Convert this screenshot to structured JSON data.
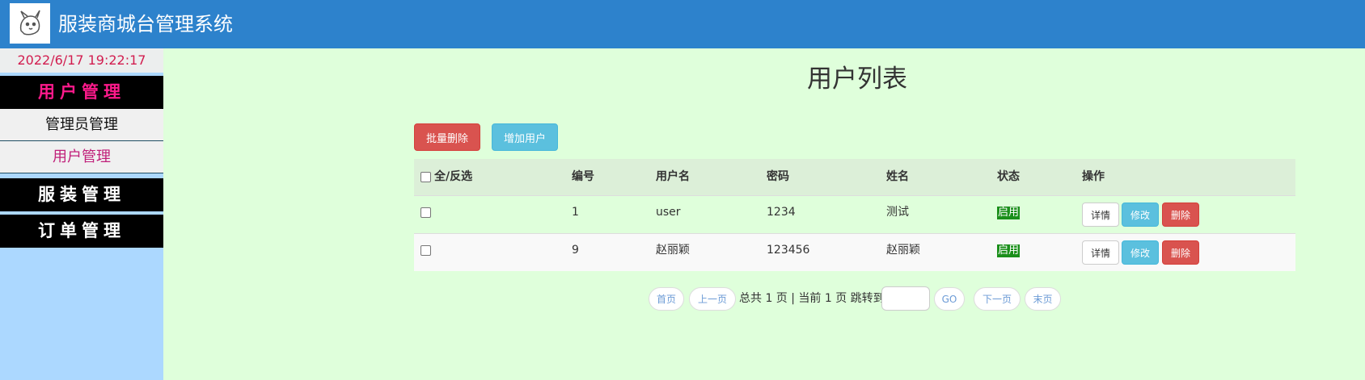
{
  "header": {
    "title": "服装商城台管理系统"
  },
  "sidebar": {
    "clock": "2022/6/17 19:22:17",
    "sections": [
      {
        "label": "用户管理",
        "items": [
          "管理员管理",
          "用户管理"
        ]
      },
      {
        "label": "服装管理"
      },
      {
        "label": "订单管理"
      }
    ]
  },
  "main": {
    "title": "用户列表",
    "actions": {
      "batch_delete": "批量删除",
      "add_user": "增加用户"
    },
    "table": {
      "columns": [
        "全/反选",
        "编号",
        "用户名",
        "密码",
        "姓名",
        "状态",
        "操作"
      ],
      "rows": [
        {
          "id": "1",
          "username": "user",
          "password": "1234",
          "name": "测试",
          "status": "启用"
        },
        {
          "id": "9",
          "username": "赵丽颖",
          "password": "123456",
          "name": "赵丽颖",
          "status": "启用"
        }
      ],
      "row_actions": {
        "detail": "详情",
        "edit": "修改",
        "delete": "删除"
      }
    },
    "pagination": {
      "first": "首页",
      "prev": "上一页",
      "summary": "总共 1 页 | 当前 1 页 跳转到",
      "jump_value": "",
      "go": "GO",
      "next": "下一页",
      "last": "末页"
    }
  },
  "colors": {
    "header_bg": "#2d82cc",
    "sidebar_bg": "#acd8ff",
    "content_bg": "#dfffdb",
    "clock_text": "#d21d4f",
    "active_menu_text": "#ff1a8c",
    "danger": "#d9534f",
    "info": "#5bc0de",
    "status_badge": "#1a8f1a"
  }
}
